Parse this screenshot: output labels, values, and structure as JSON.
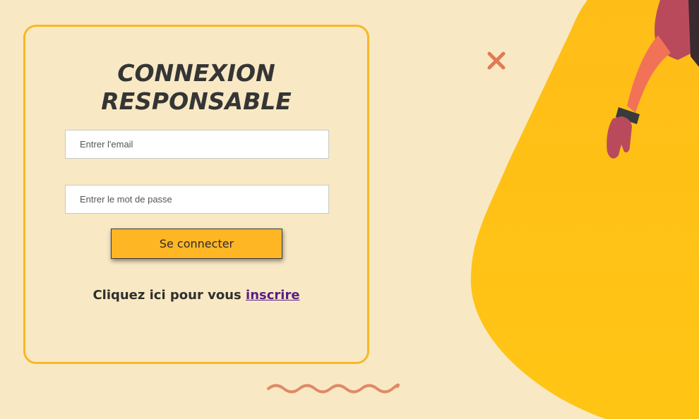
{
  "login": {
    "title": "CONNEXION RESPONSABLE",
    "email_placeholder": "Entrer l'email",
    "password_placeholder": "Entrer le mot de passe",
    "submit_label": "Se connecter",
    "signup_prompt": "Cliquez ici pour vous",
    "signup_link": "inscrire"
  },
  "colors": {
    "background": "#f8e9c4",
    "accent": "#f8b727",
    "button": "#ffb624",
    "link": "#5b1e86",
    "decor": "#e07a55"
  },
  "decor_icons": [
    "close-icon",
    "wave-squiggle",
    "illustration-figure"
  ]
}
